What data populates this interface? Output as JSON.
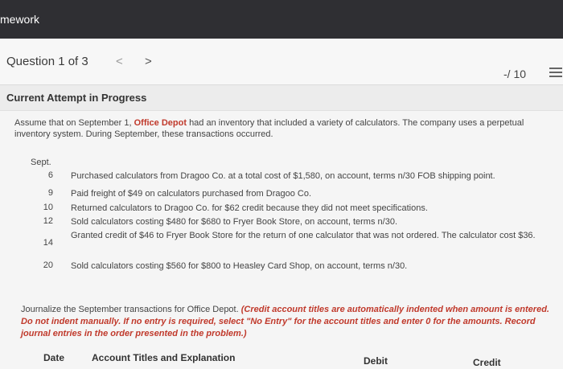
{
  "app": {
    "title": "mework"
  },
  "question_nav": {
    "label": "Question 1 of 3",
    "prev_icon": "<",
    "next_icon": ">",
    "score": "-/ 10"
  },
  "attempt": {
    "title": "Current Attempt in Progress"
  },
  "problem": {
    "intro_before": "Assume that on September 1,",
    "company": "Office Depot",
    "intro_after": "had an inventory that included a variety of calculators. The company uses a perpetual inventory system. During September, these transactions occurred.",
    "month_label": "Sept.",
    "transactions": [
      {
        "day": "6",
        "text": "Purchased calculators from Dragoo Co. at a total cost of $1,580, on account, terms n/30 FOB shipping point."
      },
      {
        "day": "9",
        "text": "Paid freight of $49 on calculators purchased from Dragoo Co."
      },
      {
        "day": "10",
        "text": "Returned calculators to Dragoo Co. for $62 credit because they did not meet specifications."
      },
      {
        "day": "12",
        "text": "Sold calculators costing $480 for $680 to Fryer Book Store, on account, terms n/30."
      },
      {
        "day": "14",
        "text": "Granted credit of $46 to Fryer Book Store for the return of one calculator that was not ordered. The calculator cost $36."
      },
      {
        "day": "20",
        "text": "Sold calculators costing $560 for $800 to Heasley Card Shop, on account, terms n/30."
      }
    ],
    "instruction_plain": "Journalize the September transactions for Office Depot.",
    "instruction_emphasis": "(Credit account titles are automatically indented when amount is entered. Do not indent manually. If no entry is required, select \"No Entry\" for the account titles and enter 0 for the amounts. Record journal entries in the order presented in the problem.)"
  },
  "table": {
    "headers": [
      "Date",
      "Account Titles and Explanation",
      "Debit",
      "Credit"
    ]
  }
}
